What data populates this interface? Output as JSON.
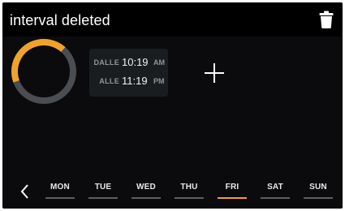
{
  "header": {
    "title": "interval deleted",
    "delete_icon": "trash-icon"
  },
  "colors": {
    "background": "#0b0b0d",
    "header": "#000000",
    "accent": "#f1a22b",
    "ring_track": "#4a4d51",
    "card": "#1a1d20"
  },
  "interval_ring": {
    "progress_fraction": 0.42
  },
  "interval": {
    "from_label": "DALLE",
    "from_time": "10:19",
    "from_ampm": "AM",
    "to_label": "ALLE",
    "to_time": "11:19",
    "to_ampm": "PM"
  },
  "actions": {
    "add_icon": "plus-icon",
    "prev_icon": "chevron-left-icon"
  },
  "days": [
    {
      "label": "MON",
      "active": false
    },
    {
      "label": "TUE",
      "active": false
    },
    {
      "label": "WED",
      "active": false
    },
    {
      "label": "THU",
      "active": false
    },
    {
      "label": "FRI",
      "active": true
    },
    {
      "label": "SAT",
      "active": false
    },
    {
      "label": "SUN",
      "active": false
    }
  ]
}
